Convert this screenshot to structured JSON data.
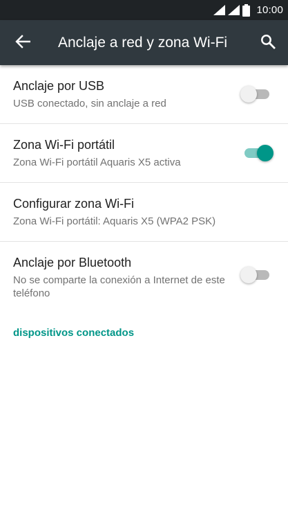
{
  "status_bar": {
    "time": "10:00",
    "icons": [
      "signal-icon",
      "signal-icon",
      "battery-icon"
    ]
  },
  "app_bar": {
    "back_icon": "arrow-left-icon",
    "title": "Anclaje a red y zona Wi-Fi",
    "search_icon": "search-icon"
  },
  "settings": [
    {
      "title": "Anclaje por USB",
      "subtitle": "USB conectado, sin anclaje a red",
      "toggle": "off"
    },
    {
      "title": "Zona Wi-Fi portátil",
      "subtitle": "Zona Wi-Fi portátil Aquaris X5 activa",
      "toggle": "on"
    },
    {
      "title": "Configurar zona Wi-Fi",
      "subtitle": "Zona Wi-Fi portátil: Aquaris X5 (WPA2 PSK)"
    },
    {
      "title": "Anclaje por Bluetooth",
      "subtitle": "No se comparte la conexión a Internet de este teléfono",
      "toggle": "off"
    }
  ],
  "connected_devices_link": "dispositivos conectados",
  "colors": {
    "status_bar": "#1f2326",
    "app_bar": "#30393f",
    "accent": "#009688",
    "accent_light": "#80cbc4",
    "switch_off_track": "#b9b9b9",
    "switch_off_thumb": "#f1f1f1"
  }
}
